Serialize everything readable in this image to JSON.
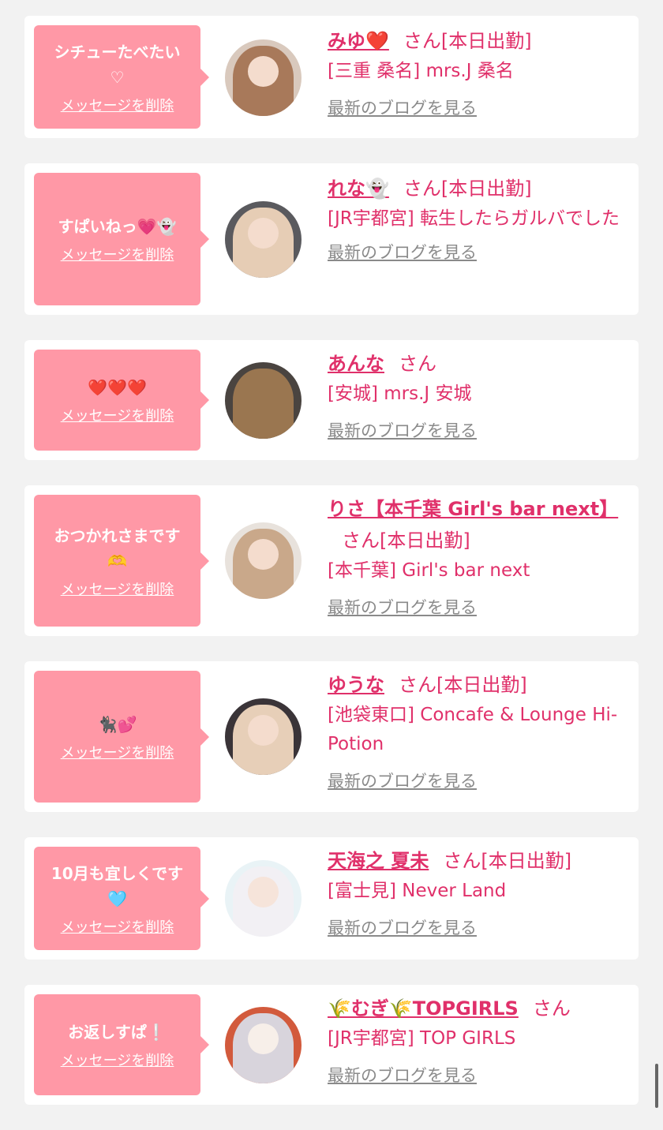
{
  "delete_label": "メッセージを削除",
  "blog_label": "最新のブログを見る",
  "san_label": "さん",
  "items": [
    {
      "message": "シチューたべたい\n♡",
      "name": "みゆ❤️",
      "suffix": "[本日出勤]",
      "shop": "[三重 桑名] mrs.J 桑名"
    },
    {
      "message": "すぱいねっ💗👻",
      "name": "れな👻",
      "suffix": "[本日出勤]",
      "shop": "[JR宇都宮] 転生したらガルバでした"
    },
    {
      "message": "❤️❤️❤️",
      "name": "あんな",
      "suffix": "",
      "shop": "[安城] mrs.J 安城"
    },
    {
      "message": "おつかれさまです\n🫶",
      "name": "りさ【本千葉 Girl's bar next】",
      "suffix": "[本日出勤]",
      "shop": "[本千葉] Girl's bar next"
    },
    {
      "message": "🐈‍⬛💕",
      "name": "ゆうな",
      "suffix": "[本日出勤]",
      "shop": "[池袋東口] Concafe & Lounge Hi-Potion"
    },
    {
      "message": "10月も宜しくです\n🩵",
      "name": "天海之 夏未",
      "suffix": "[本日出勤]",
      "shop": "[富士見] Never Land"
    },
    {
      "message": "お返しすぱ❕",
      "name": "🌾むぎ🌾TOPGIRLS",
      "suffix": "",
      "shop": "[JR宇都宮] TOP GIRLS"
    }
  ]
}
